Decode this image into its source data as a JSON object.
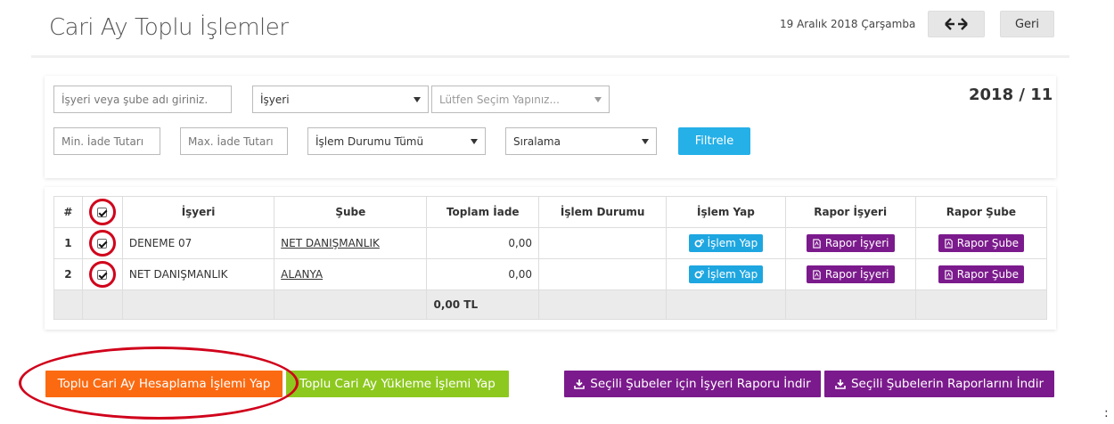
{
  "header": {
    "title": "Cari Ay Toplu İşlemler",
    "date": "19 Aralık 2018 Çarşamba",
    "arrows_label": "↔",
    "back_label": "Geri"
  },
  "filters": {
    "search_placeholder": "İşyeri veya şube adı giriniz.",
    "type_select": "İşyeri",
    "choice_select": "Lütfen Seçim Yapınız...",
    "min_placeholder": "Min. İade Tutarı",
    "max_placeholder": "Max. İade Tutarı",
    "status_select": "İşlem Durumu Tümü",
    "sort_select": "Sıralama",
    "filter_label": "Filtrele",
    "period": "2018 / 11"
  },
  "table": {
    "headers": [
      "#",
      "",
      "İşyeri",
      "Şube",
      "Toplam İade",
      "İşlem Durumu",
      "İşlem Yap",
      "Rapor İşyeri",
      "Rapor Şube"
    ],
    "rows": [
      {
        "no": "1",
        "business": "DENEME 07",
        "branch": "NET DANIŞMANLIK",
        "total": "0,00",
        "status": "",
        "action": "İşlem Yap",
        "report_business": "Rapor İşyeri",
        "report_branch": "Rapor Şube"
      },
      {
        "no": "2",
        "business": "NET DANIŞMANLIK",
        "branch": "ALANYA",
        "total": "0,00",
        "status": "",
        "action": "İşlem Yap",
        "report_business": "Rapor İşyeri",
        "report_branch": "Rapor Şube"
      }
    ],
    "grand_total": "0,00 TL"
  },
  "actions": {
    "bulk_calc": "Toplu Cari Ay Hesaplama İşlemi Yap",
    "bulk_upload": "Toplu Cari Ay Yükleme İşlemi Yap",
    "download_business_report": "Seçili Şubeler için İşyeri Raporu İndir",
    "download_branch_reports": "Seçili Şubelerin Raporlarını İndir"
  },
  "colors": {
    "orange": "#fb6a11",
    "green": "#8dc81f",
    "purple": "#7b1a8c",
    "blue": "#1ea6e0",
    "annotation_red": "#d0021b"
  },
  "stray_mark": ":"
}
